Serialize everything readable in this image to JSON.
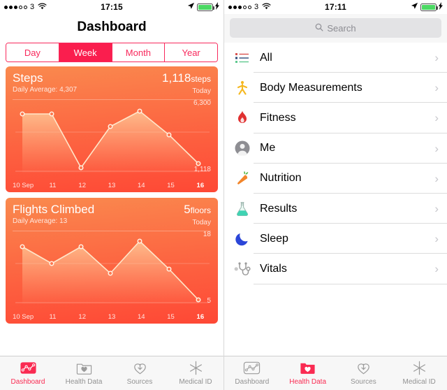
{
  "left": {
    "status": {
      "carrier": "3",
      "time": "17:15",
      "signal_filled": 3,
      "signal_total": 5,
      "wifi_icon": "wifi-icon",
      "location_icon": "location-arrow-icon",
      "battery_icon": "battery-icon",
      "charging_icon": "lightning-bolt-icon",
      "battery_color": "#4cd964"
    },
    "title": "Dashboard",
    "segmented": {
      "options": [
        "Day",
        "Week",
        "Month",
        "Year"
      ],
      "selected": "Week",
      "accent": "#fa1e4e"
    },
    "tabs": [
      {
        "label": "Dashboard",
        "icon": "dashboard-chart-icon",
        "active": true
      },
      {
        "label": "Health Data",
        "icon": "folder-heart-icon",
        "active": false
      },
      {
        "label": "Sources",
        "icon": "download-heart-icon",
        "active": false
      },
      {
        "label": "Medical ID",
        "icon": "medical-asterisk-icon",
        "active": false
      }
    ]
  },
  "right": {
    "status": {
      "carrier": "3",
      "time": "17:11",
      "signal_filled": 3,
      "signal_total": 5,
      "wifi_icon": "wifi-icon",
      "location_icon": "location-arrow-icon",
      "battery_icon": "battery-icon",
      "charging_icon": "lightning-bolt-icon",
      "battery_color": "#4cd964"
    },
    "search": {
      "placeholder": "Search",
      "value": "",
      "icon": "search-icon"
    },
    "list": [
      {
        "label": "All",
        "icon": "list-lines-icon",
        "chevron": "›"
      },
      {
        "label": "Body Measurements",
        "icon": "walking-person-icon",
        "chevron": "›"
      },
      {
        "label": "Fitness",
        "icon": "flame-icon",
        "chevron": "›"
      },
      {
        "label": "Me",
        "icon": "person-avatar-icon",
        "chevron": "›"
      },
      {
        "label": "Nutrition",
        "icon": "carrot-icon",
        "chevron": "›"
      },
      {
        "label": "Results",
        "icon": "flask-icon",
        "chevron": "›"
      },
      {
        "label": "Sleep",
        "icon": "crescent-moon-icon",
        "chevron": "›"
      },
      {
        "label": "Vitals",
        "icon": "stethoscope-icon",
        "chevron": "›"
      }
    ],
    "tabs": [
      {
        "label": "Dashboard",
        "icon": "dashboard-chart-icon",
        "active": false
      },
      {
        "label": "Health Data",
        "icon": "folder-heart-icon",
        "active": true
      },
      {
        "label": "Sources",
        "icon": "download-heart-icon",
        "active": false
      },
      {
        "label": "Medical ID",
        "icon": "medical-asterisk-icon",
        "active": false
      }
    ]
  },
  "chart_data": [
    {
      "type": "line",
      "title": "Steps",
      "subtitle": "Daily Average: 4,307",
      "value": "1,118",
      "unit": "steps",
      "period": "Today",
      "ylabel": "",
      "xlabel": "",
      "ymax_label": "6,300",
      "ymin_label": "1,118",
      "ylim": [
        1118,
        6300
      ],
      "categories": [
        "10 Sep",
        "11",
        "12",
        "13",
        "14",
        "15",
        "16"
      ],
      "highlight_category": "16",
      "values": [
        5400,
        5400,
        1900,
        4550,
        5800,
        4250,
        1118
      ],
      "grid": true,
      "legend": "none"
    },
    {
      "type": "line",
      "title": "Flights Climbed",
      "subtitle": "Daily Average: 13",
      "value": "5",
      "unit": "floors",
      "period": "Today",
      "ylabel": "",
      "xlabel": "",
      "ymax_label": "18",
      "ymin_label": "5",
      "ylim": [
        5,
        18
      ],
      "categories": [
        "10 Sep",
        "11",
        "12",
        "13",
        "14",
        "15",
        "16"
      ],
      "highlight_category": "16",
      "values": [
        16,
        13,
        16,
        11.5,
        18,
        12,
        5
      ],
      "grid": true,
      "legend": "none"
    }
  ]
}
